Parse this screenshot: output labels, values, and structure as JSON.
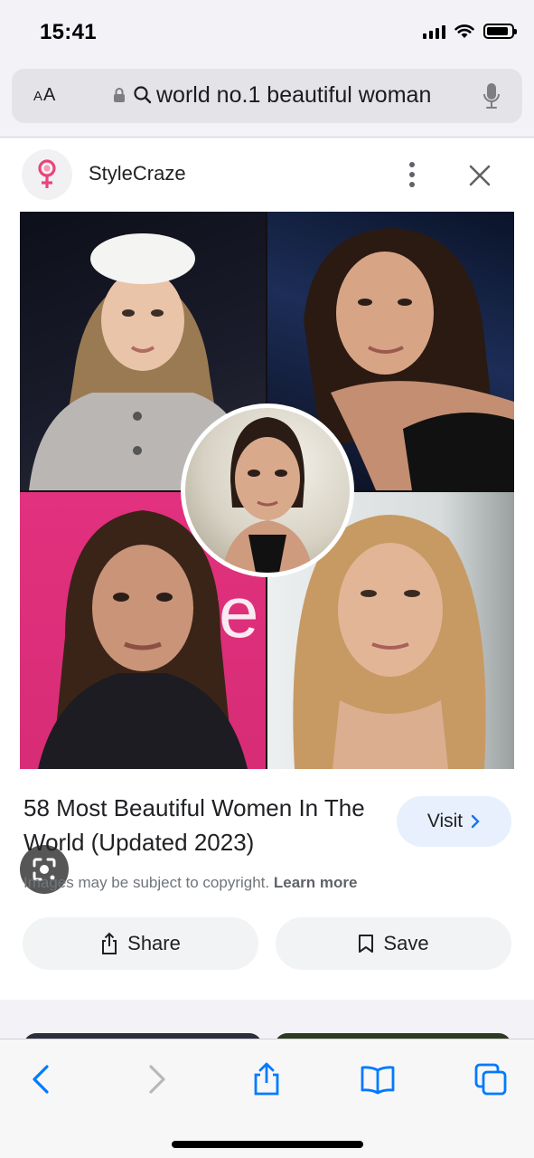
{
  "status_bar": {
    "time": "15:41",
    "signal_bars": 4,
    "battery_level": 0.9
  },
  "address_bar": {
    "text_size_label_big": "A",
    "text_size_label_small": "A",
    "query": "world no.1 beautiful woman",
    "icons": [
      "lock-icon",
      "search-icon",
      "microphone-icon"
    ]
  },
  "result_card": {
    "source": {
      "name": "StyleCraze",
      "logo_icon": "stylecraze-logo-icon"
    },
    "image": {
      "type": "collage",
      "lens_icon": "lens-icon"
    },
    "title": "58 Most Beautiful Women In The World (Updated 2023)",
    "visit_label": "Visit",
    "copyright_text": "Images may be subject to copyright.",
    "learn_more": "Learn more",
    "share_label": "Share",
    "save_label": "Save"
  },
  "toolbar": {
    "icons": [
      "back-icon",
      "forward-icon",
      "share-icon",
      "bookmarks-icon",
      "tabs-icon"
    ]
  },
  "colors": {
    "accent": "#1a73e8",
    "safari_blue": "#007aff",
    "visit_bg": "#e8f0fe",
    "logo_pink": "#e8457a"
  }
}
